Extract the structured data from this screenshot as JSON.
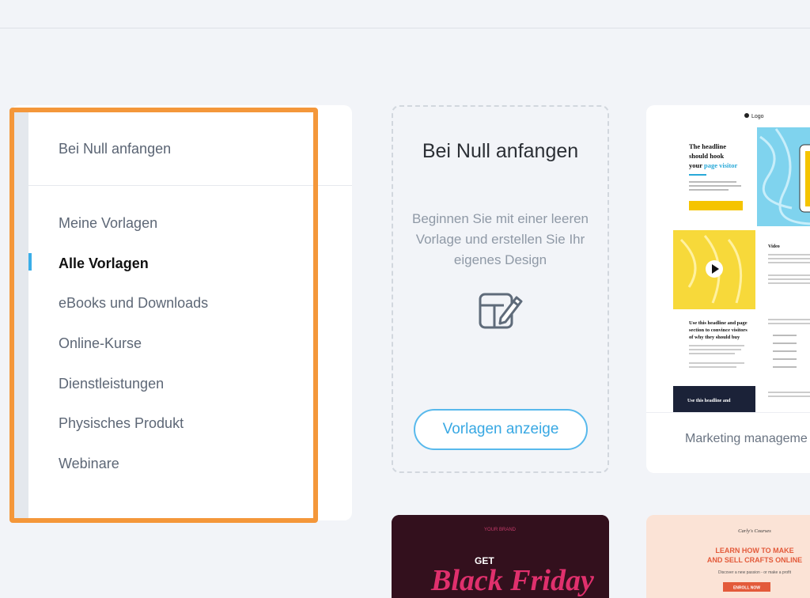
{
  "sidebar": {
    "start_label": "Bei Null anfangen",
    "items": [
      {
        "label": "Meine Vorlagen"
      },
      {
        "label": "Alle Vorlagen",
        "active": true
      },
      {
        "label": "eBooks und Downloads"
      },
      {
        "label": "Online-Kurse"
      },
      {
        "label": "Dienstleistungen"
      },
      {
        "label": "Physisches Produkt"
      },
      {
        "label": "Webinare"
      }
    ]
  },
  "blank_card": {
    "title": "Bei Null anfangen",
    "description": "Beginnen Sie mit einer leeren Vorlage und erstellen Sie Ihr eigenes Design",
    "icon": "edit-template-icon",
    "button_label": "Vorlagen anzeige"
  },
  "template_card": {
    "caption": "Marketing manageme",
    "preview": {
      "logo_text": "Logo",
      "headline_a": "The headline should hook your",
      "headline_b": "page visitor",
      "video_title": "Video",
      "sub_headline": "Use this headline and page section to convince visitors of why they should buy",
      "footer_headline": "Use this headline and"
    }
  },
  "thumbnails": {
    "dark": {
      "top_text": "YOUR BRAND",
      "get_text": "GET",
      "script_text": "Black Friday"
    },
    "light": {
      "brand_text": "Carly's Courses",
      "headline": "LEARN HOW TO MAKE AND SELL CRAFTS ONLINE",
      "subline": "Discover a new passion - or make a profit",
      "cta": "ENROLL NOW"
    }
  },
  "colors": {
    "accent": "#38a8e3",
    "highlight": "#f4973a",
    "active_bar": "#3aaee8"
  }
}
